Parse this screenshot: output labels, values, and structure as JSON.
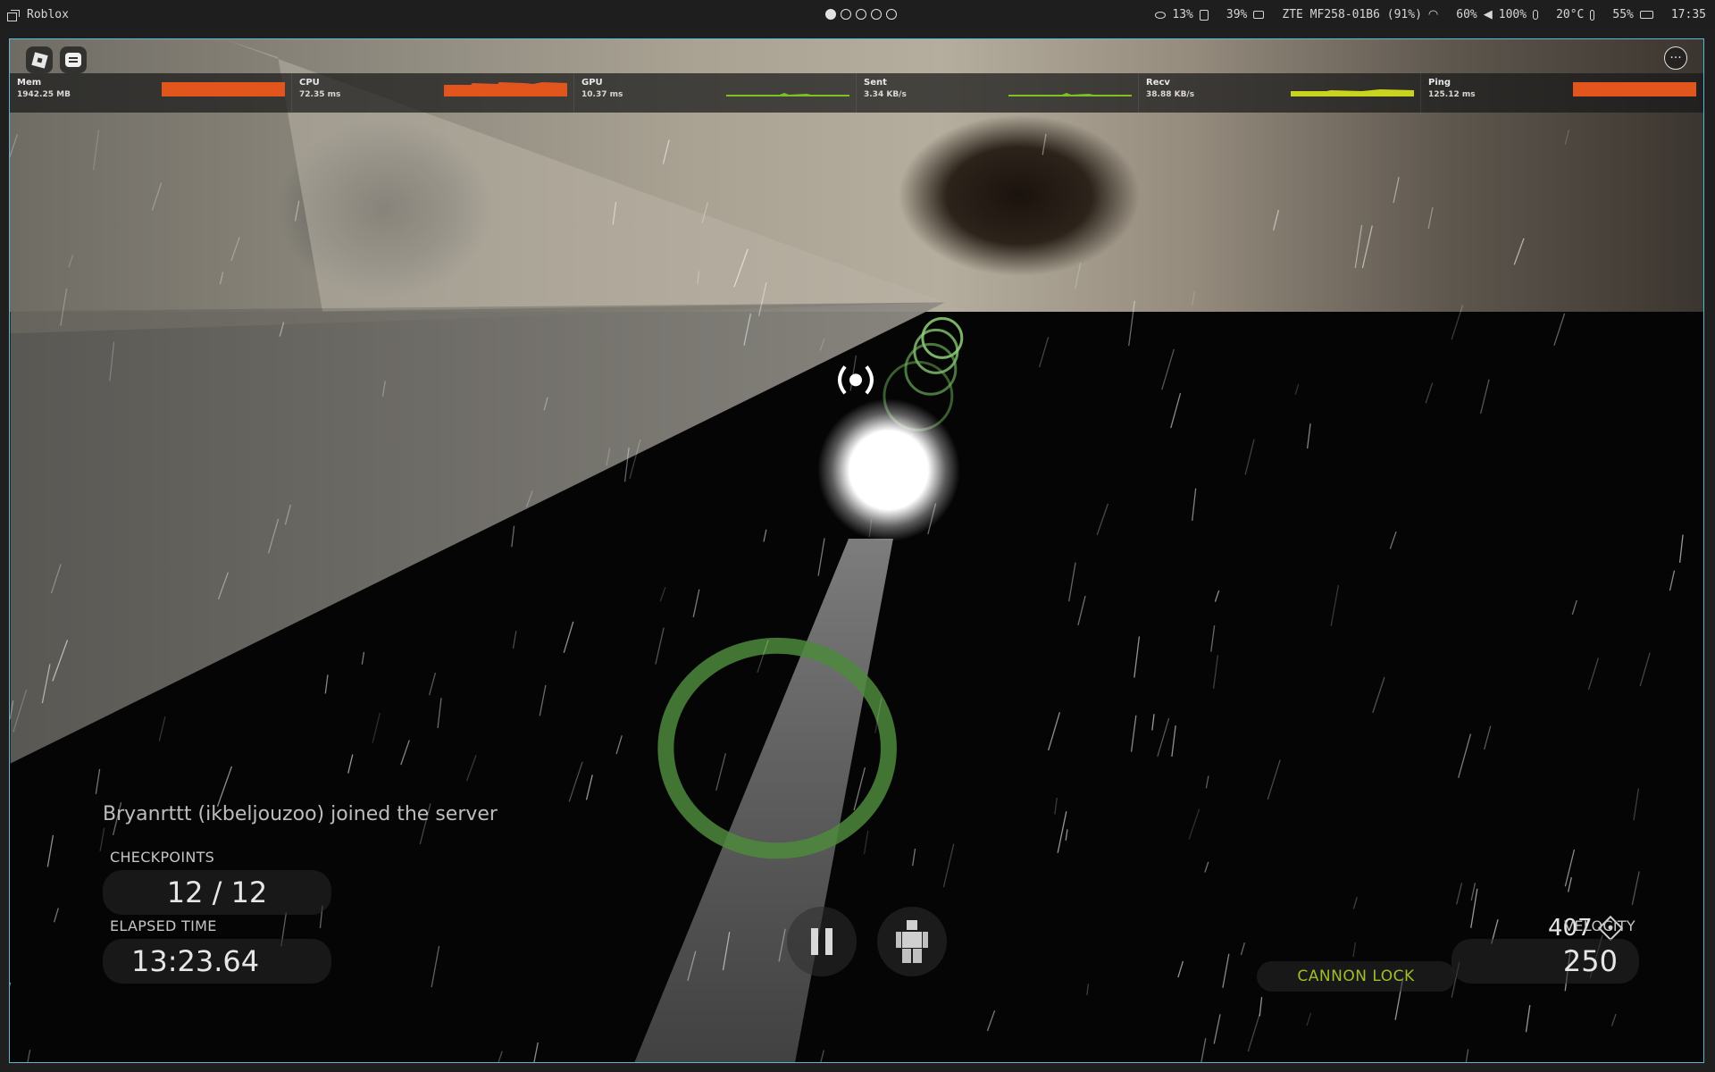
{
  "topbar": {
    "app_title": "Roblox",
    "workspaces": [
      true,
      false,
      false,
      false,
      false
    ],
    "privacy_pct": "13%",
    "battery_small_pct": "39%",
    "network_name": "ZTE MF258-01B6 (91%)",
    "brightness_pct": "60%",
    "volume_pct": "100%",
    "temperature": "20°C",
    "battery_pct": "55%",
    "clock": "17:35"
  },
  "stats": [
    {
      "name": "Mem",
      "value": "1942.25 MB",
      "color": "#e2561d",
      "kind": "full"
    },
    {
      "name": "CPU",
      "value": "72.35 ms",
      "color": "#e2561d",
      "kind": "spiky"
    },
    {
      "name": "GPU",
      "value": "10.37 ms",
      "color": "#7cc222",
      "kind": "line"
    },
    {
      "name": "Sent",
      "value": "3.34 KB/s",
      "color": "#7cc222",
      "kind": "line"
    },
    {
      "name": "Recv",
      "value": "38.88 KB/s",
      "color": "#c8d41e",
      "kind": "thick"
    },
    {
      "name": "Ping",
      "value": "125.12 ms",
      "color": "#e2561d",
      "kind": "full"
    }
  ],
  "hud": {
    "join_message": "Bryanrttt (ikbeljouzoo) joined the server",
    "checkpoints_label": "CHECKPOINTS",
    "checkpoints_value": "12 / 12",
    "elapsed_label": "ELAPSED TIME",
    "elapsed_value": "13:23.64",
    "score": "407",
    "velocity_label": "VELOCITY",
    "velocity_value": "250",
    "cannon_lock": "CANNON LOCK"
  },
  "colors": {
    "accent_border": "#5bb7d6",
    "ring_green": "#5f9c4f",
    "cannon_lock": "#9fbf2a"
  }
}
